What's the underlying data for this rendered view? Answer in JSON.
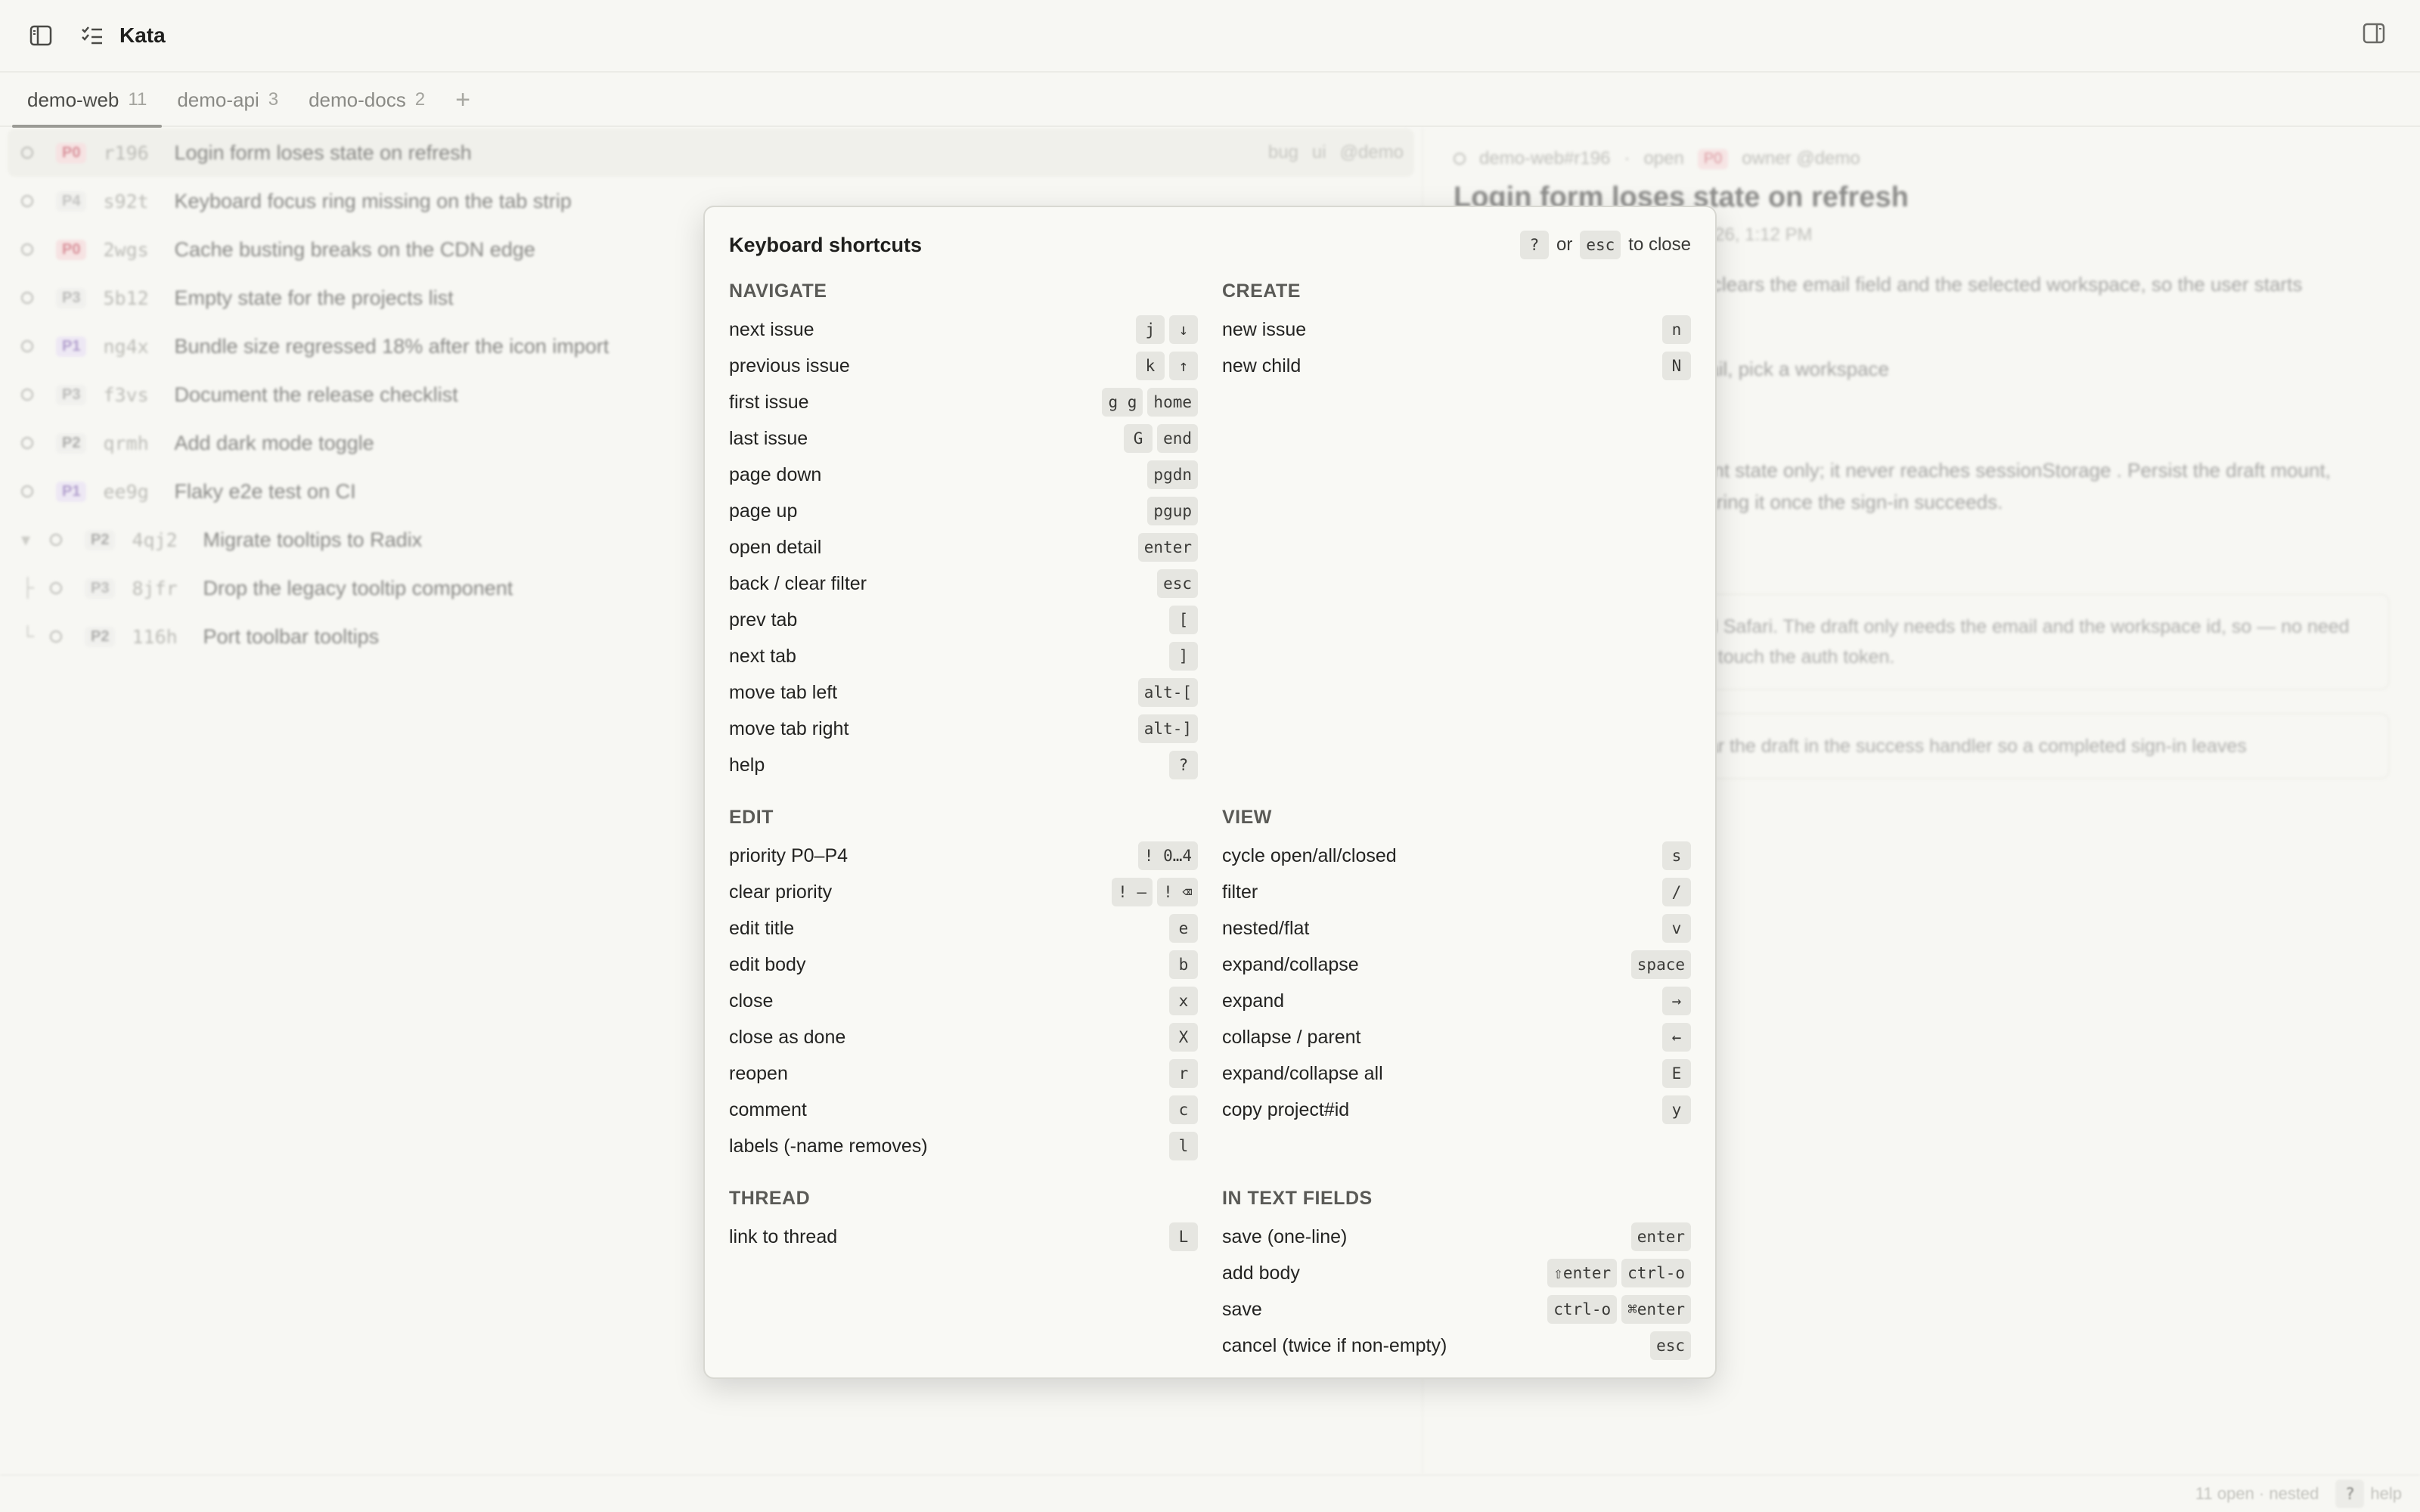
{
  "app": {
    "title": "Kata"
  },
  "tabs": [
    {
      "label": "demo-web",
      "count": "11",
      "active": true
    },
    {
      "label": "demo-api",
      "count": "3"
    },
    {
      "label": "demo-docs",
      "count": "2"
    }
  ],
  "tab_add": "+",
  "issues": [
    {
      "priority": "P0",
      "id": "r196",
      "title": "Login form loses state on refresh",
      "tags": [
        "bug",
        "ui",
        "@demo"
      ],
      "selected": true
    },
    {
      "priority": "P4",
      "id": "s92t",
      "title": "Keyboard focus ring missing on the tab strip",
      "tags": []
    },
    {
      "priority": "P0",
      "id": "2wgs",
      "title": "Cache busting breaks on the CDN edge",
      "tags": []
    },
    {
      "priority": "P3",
      "id": "5b12",
      "title": "Empty state for the projects list",
      "tags": []
    },
    {
      "priority": "P1",
      "id": "ng4x",
      "title": "Bundle size regressed 18% after the icon import",
      "tags": []
    },
    {
      "priority": "P3",
      "id": "f3vs",
      "title": "Document the release checklist",
      "tags": []
    },
    {
      "priority": "P2",
      "id": "qrmh",
      "title": "Add dark mode toggle",
      "tags": []
    },
    {
      "priority": "P1",
      "id": "ee9g",
      "title": "Flaky e2e test on CI",
      "tags": []
    },
    {
      "priority": "P2",
      "id": "4qj2",
      "title": "Migrate tooltips to Radix",
      "tags": [],
      "parent": true
    },
    {
      "priority": "P3",
      "id": "8jfr",
      "title": "Drop the legacy tooltip component",
      "tags": [],
      "child": true
    },
    {
      "priority": "P2",
      "id": "116h",
      "title": "Port toolbar tooltips",
      "tags": [],
      "child": true,
      "last": true
    }
  ],
  "detail": {
    "ref": "demo-web#r196",
    "state": "open",
    "priority": "P0",
    "owner": "owner @demo",
    "title": "Login form loses state on refresh",
    "updated": "6, 1:11 PM · updated Sep 23, 2026, 1:12 PM",
    "body1": "nin clears the email field and the selected workspace, so the user starts",
    "body2": "email, pick a workspace",
    "body3": "ain",
    "body4": "onent state only; it never reaches sessionStorage . Persist the draft mount, clearing it once the sign-in succeeds.",
    "comment1": "nd Safari. The draft only needs the email and the workspace id, so — no need to touch the auth token.",
    "comment2": "ear the draft in the success handler so a completed sign-in leaves"
  },
  "statusbar": {
    "summary": "11 open · nested",
    "help_key": "?",
    "help_label": "help"
  },
  "modal": {
    "title": "Keyboard shortcuts",
    "close_key1": "?",
    "close_or": "or",
    "close_key2": "esc",
    "close_text": "to close",
    "left": [
      {
        "title": "NAVIGATE",
        "items": [
          {
            "label": "next issue",
            "keys": [
              "j",
              "↓"
            ]
          },
          {
            "label": "previous issue",
            "keys": [
              "k",
              "↑"
            ]
          },
          {
            "label": "first issue",
            "keys": [
              "g g",
              "home"
            ]
          },
          {
            "label": "last issue",
            "keys": [
              "G",
              "end"
            ]
          },
          {
            "label": "page down",
            "keys": [
              "pgdn"
            ]
          },
          {
            "label": "page up",
            "keys": [
              "pgup"
            ]
          },
          {
            "label": "open detail",
            "keys": [
              "enter"
            ]
          },
          {
            "label": "back / clear filter",
            "keys": [
              "esc"
            ]
          },
          {
            "label": "prev tab",
            "keys": [
              "["
            ]
          },
          {
            "label": "next tab",
            "keys": [
              "]"
            ]
          },
          {
            "label": "move tab left",
            "keys": [
              "alt-["
            ]
          },
          {
            "label": "move tab right",
            "keys": [
              "alt-]"
            ]
          },
          {
            "label": "help",
            "keys": [
              "?"
            ]
          }
        ]
      },
      {
        "title": "EDIT",
        "items": [
          {
            "label": "priority P0–P4",
            "keys": [
              "! 0…4"
            ]
          },
          {
            "label": "clear priority",
            "keys": [
              "! –",
              "! ⌫"
            ]
          },
          {
            "label": "edit title",
            "keys": [
              "e"
            ]
          },
          {
            "label": "edit body",
            "keys": [
              "b"
            ]
          },
          {
            "label": "close",
            "keys": [
              "x"
            ]
          },
          {
            "label": "close as done",
            "keys": [
              "X"
            ]
          },
          {
            "label": "reopen",
            "keys": [
              "r"
            ]
          },
          {
            "label": "comment",
            "keys": [
              "c"
            ]
          },
          {
            "label": "labels (-name removes)",
            "keys": [
              "l"
            ]
          }
        ]
      },
      {
        "title": "THREAD",
        "items": [
          {
            "label": "link to thread",
            "keys": [
              "L"
            ]
          }
        ]
      }
    ],
    "right": [
      {
        "title": "CREATE",
        "items": [
          {
            "label": "new issue",
            "keys": [
              "n"
            ]
          },
          {
            "label": "new child",
            "keys": [
              "N"
            ]
          }
        ],
        "spacer_rows": 11
      },
      {
        "title": "VIEW",
        "items": [
          {
            "label": "cycle open/all/closed",
            "keys": [
              "s"
            ]
          },
          {
            "label": "filter",
            "keys": [
              "/"
            ]
          },
          {
            "label": "nested/flat",
            "keys": [
              "v"
            ]
          },
          {
            "label": "expand/collapse",
            "keys": [
              "space"
            ]
          },
          {
            "label": "expand",
            "keys": [
              "→"
            ]
          },
          {
            "label": "collapse / parent",
            "keys": [
              "←"
            ]
          },
          {
            "label": "expand/collapse all",
            "keys": [
              "E"
            ]
          },
          {
            "label": "copy project#id",
            "keys": [
              "y"
            ]
          }
        ],
        "spacer_rows": 1
      },
      {
        "title": "IN TEXT FIELDS",
        "items": [
          {
            "label": "save (one-line)",
            "keys": [
              "enter"
            ]
          },
          {
            "label": "add body",
            "keys": [
              "⇧enter",
              "ctrl-o"
            ]
          },
          {
            "label": "save",
            "keys": [
              "ctrl-o",
              "⌘enter"
            ]
          },
          {
            "label": "cancel (twice if non-empty)",
            "keys": [
              "esc"
            ]
          }
        ]
      }
    ]
  }
}
